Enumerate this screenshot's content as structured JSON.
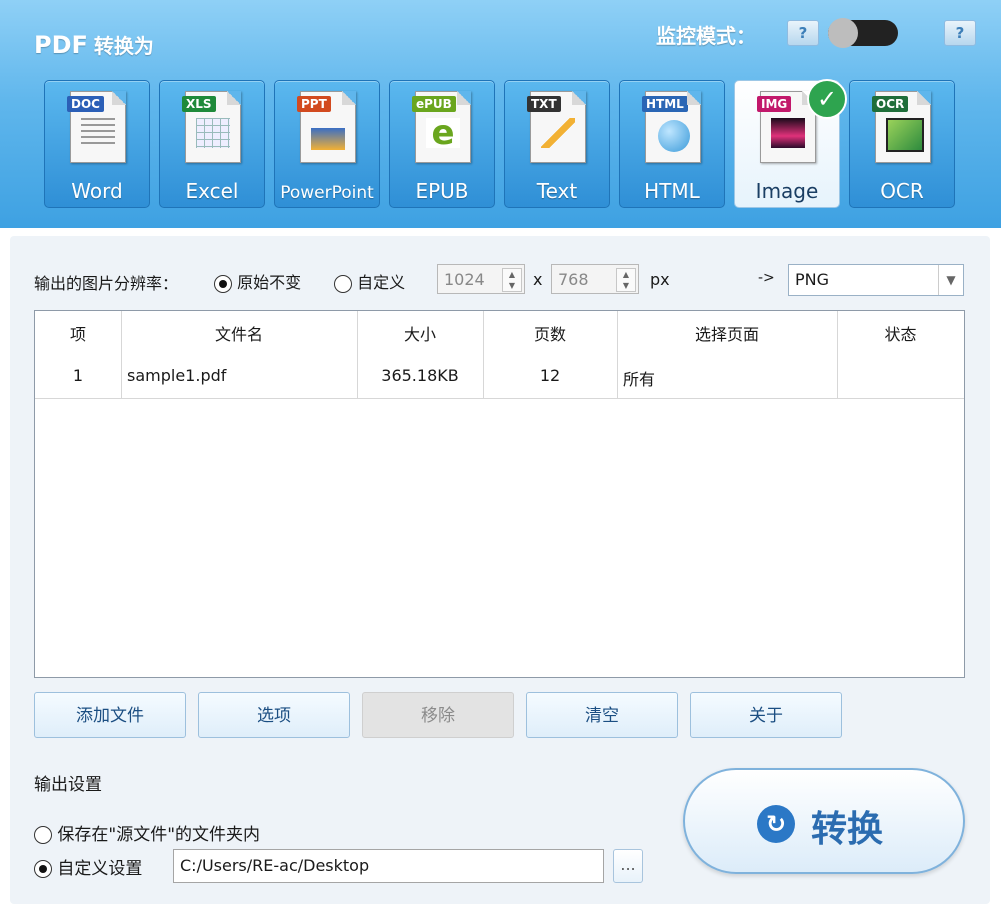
{
  "header": {
    "title_latin": "PDF",
    "title_cn": "转换为",
    "monitor_label": "监控模式：",
    "help": "?",
    "monitor_toggle_on": false
  },
  "formats": [
    {
      "badge": "DOC",
      "label": "Word",
      "badge_color": "#2b5fb7",
      "icon": "word-doc-icon"
    },
    {
      "badge": "XLS",
      "label": "Excel",
      "badge_color": "#1f8a3a",
      "icon": "excel-doc-icon"
    },
    {
      "badge": "PPT",
      "label": "PowerPoint",
      "badge_color": "#d24a1f",
      "icon": "powerpoint-doc-icon"
    },
    {
      "badge": "ePUB",
      "label": "EPUB",
      "badge_color": "#6aa61e",
      "icon": "epub-doc-icon"
    },
    {
      "badge": "TXT",
      "label": "Text",
      "badge_color": "#333333",
      "icon": "text-doc-icon"
    },
    {
      "badge": "HTML",
      "label": "HTML",
      "badge_color": "#2a66b5",
      "icon": "html-doc-icon"
    },
    {
      "badge": "IMG",
      "label": "Image",
      "badge_color": "#c2186b",
      "icon": "image-doc-icon",
      "selected": true
    },
    {
      "badge": "OCR",
      "label": "OCR",
      "badge_color": "#1f6e3a",
      "icon": "ocr-doc-icon"
    }
  ],
  "resolution": {
    "label": "输出的图片分辨率：",
    "opt_original": "原始不变",
    "opt_custom": "自定义",
    "selected": "original",
    "width": "1024",
    "x": "x",
    "height": "768",
    "unit": "px",
    "arrow": "->",
    "format": "PNG"
  },
  "table": {
    "columns": [
      "项",
      "文件名",
      "大小",
      "页数",
      "选择页面",
      "状态"
    ],
    "rows": [
      {
        "index": "1",
        "filename": "sample1.pdf",
        "size": "365.18KB",
        "pages": "12",
        "page_selection": "所有",
        "status": ""
      }
    ]
  },
  "actions": {
    "add": "添加文件",
    "options": "选项",
    "remove": "移除",
    "clear": "清空",
    "about": "关于"
  },
  "output": {
    "title": "输出设置",
    "opt_source": "保存在\"源文件\"的文件夹内",
    "opt_custom": "自定义设置",
    "selected": "custom",
    "path": "C:/Users/RE-ac/Desktop",
    "browse": "..."
  },
  "convert": {
    "label": "转换"
  },
  "colors": {
    "header_top": "#8fd0f6",
    "header_bottom": "#3ea1e2",
    "accent": "#2b78c6",
    "check": "#2ea44f"
  }
}
